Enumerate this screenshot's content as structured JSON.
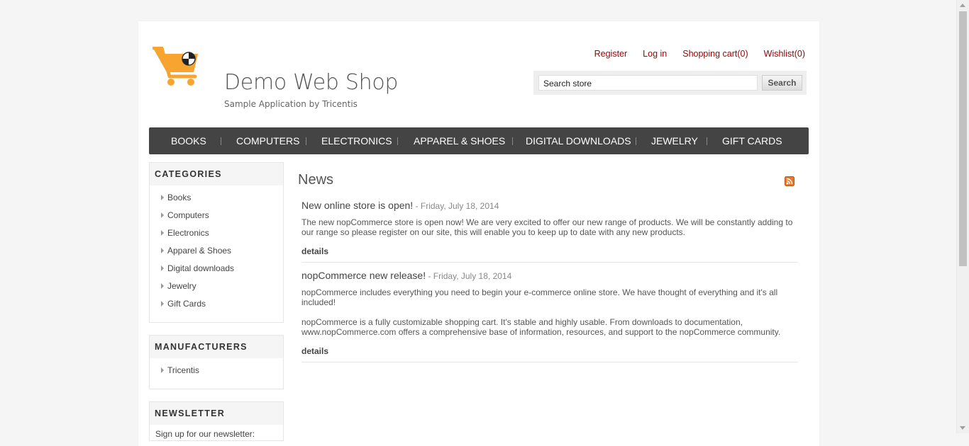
{
  "header": {
    "title": "Demo Web Shop",
    "subtitle": "Sample Application by Tricentis",
    "links": {
      "register": "Register",
      "login": "Log in",
      "cart": "Shopping cart(0)",
      "wishlist": "Wishlist(0)"
    },
    "search": {
      "value": "Search store",
      "button": "Search"
    }
  },
  "menu": [
    "BOOKS",
    "COMPUTERS",
    "ELECTRONICS",
    "APPAREL & SHOES",
    "DIGITAL DOWNLOADS",
    "JEWELRY",
    "GIFT CARDS"
  ],
  "sidebar": {
    "categories": {
      "title": "CATEGORIES",
      "items": [
        "Books",
        "Computers",
        "Electronics",
        "Apparel & Shoes",
        "Digital downloads",
        "Jewelry",
        "Gift Cards"
      ]
    },
    "manufacturers": {
      "title": "MANUFACTURERS",
      "items": [
        "Tricentis"
      ]
    },
    "newsletter": {
      "title": "NEWSLETTER",
      "text": "Sign up for our newsletter:"
    }
  },
  "news": {
    "title": "News",
    "items": [
      {
        "title": "New online store is open!",
        "date": " - Friday, July 18, 2014",
        "body": [
          "The new nopCommerce store is open now! We are very excited to offer our new range of products. We will be constantly adding to our range so please register on our site, this will enable you to keep up to date with any new products."
        ],
        "details": "details"
      },
      {
        "title": "nopCommerce new release!",
        "date": " - Friday, July 18, 2014",
        "body": [
          "nopCommerce includes everything you need to begin your e-commerce online store. We have thought of everything and it's all included!",
          "nopCommerce is a fully customizable shopping cart. It's stable and highly usable. From downloads to documentation, www.nopCommerce.com offers a comprehensive base of information, resources, and support to the nopCommerce community."
        ],
        "details": "details"
      }
    ]
  },
  "colors": {
    "link": "#990000",
    "menu_bg": "#444444",
    "cart_orange": "#f7a530"
  }
}
